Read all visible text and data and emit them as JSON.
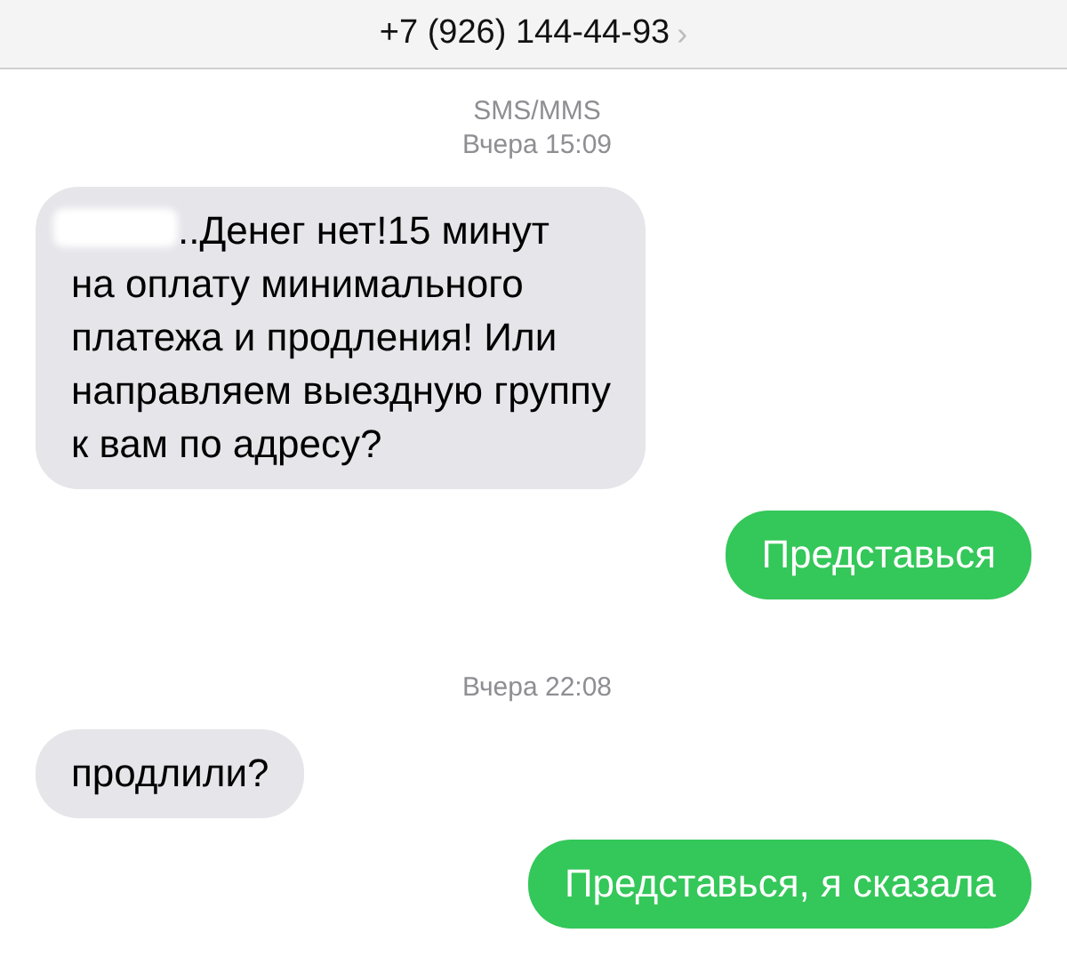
{
  "header": {
    "title": "+7 (926) 144-44-93",
    "chevron": "›"
  },
  "thread": [
    {
      "kind": "stamp",
      "lines": [
        "SMS/MMS",
        "Вчера 15:09"
      ]
    },
    {
      "kind": "incoming",
      "redacted": true,
      "text": "..Денег нет!15 минут\nна оплату минимального\nплатежа и продления! Или\nнаправляем выездную группу\nк вам по адресу?"
    },
    {
      "kind": "outgoing",
      "redacted": false,
      "text": "Представься"
    },
    {
      "kind": "stamp",
      "lines": [
        "Вчера 22:08"
      ]
    },
    {
      "kind": "incoming",
      "redacted": false,
      "text": "продлили?"
    },
    {
      "kind": "outgoing",
      "redacted": false,
      "text": "Представься, я сказала"
    }
  ]
}
